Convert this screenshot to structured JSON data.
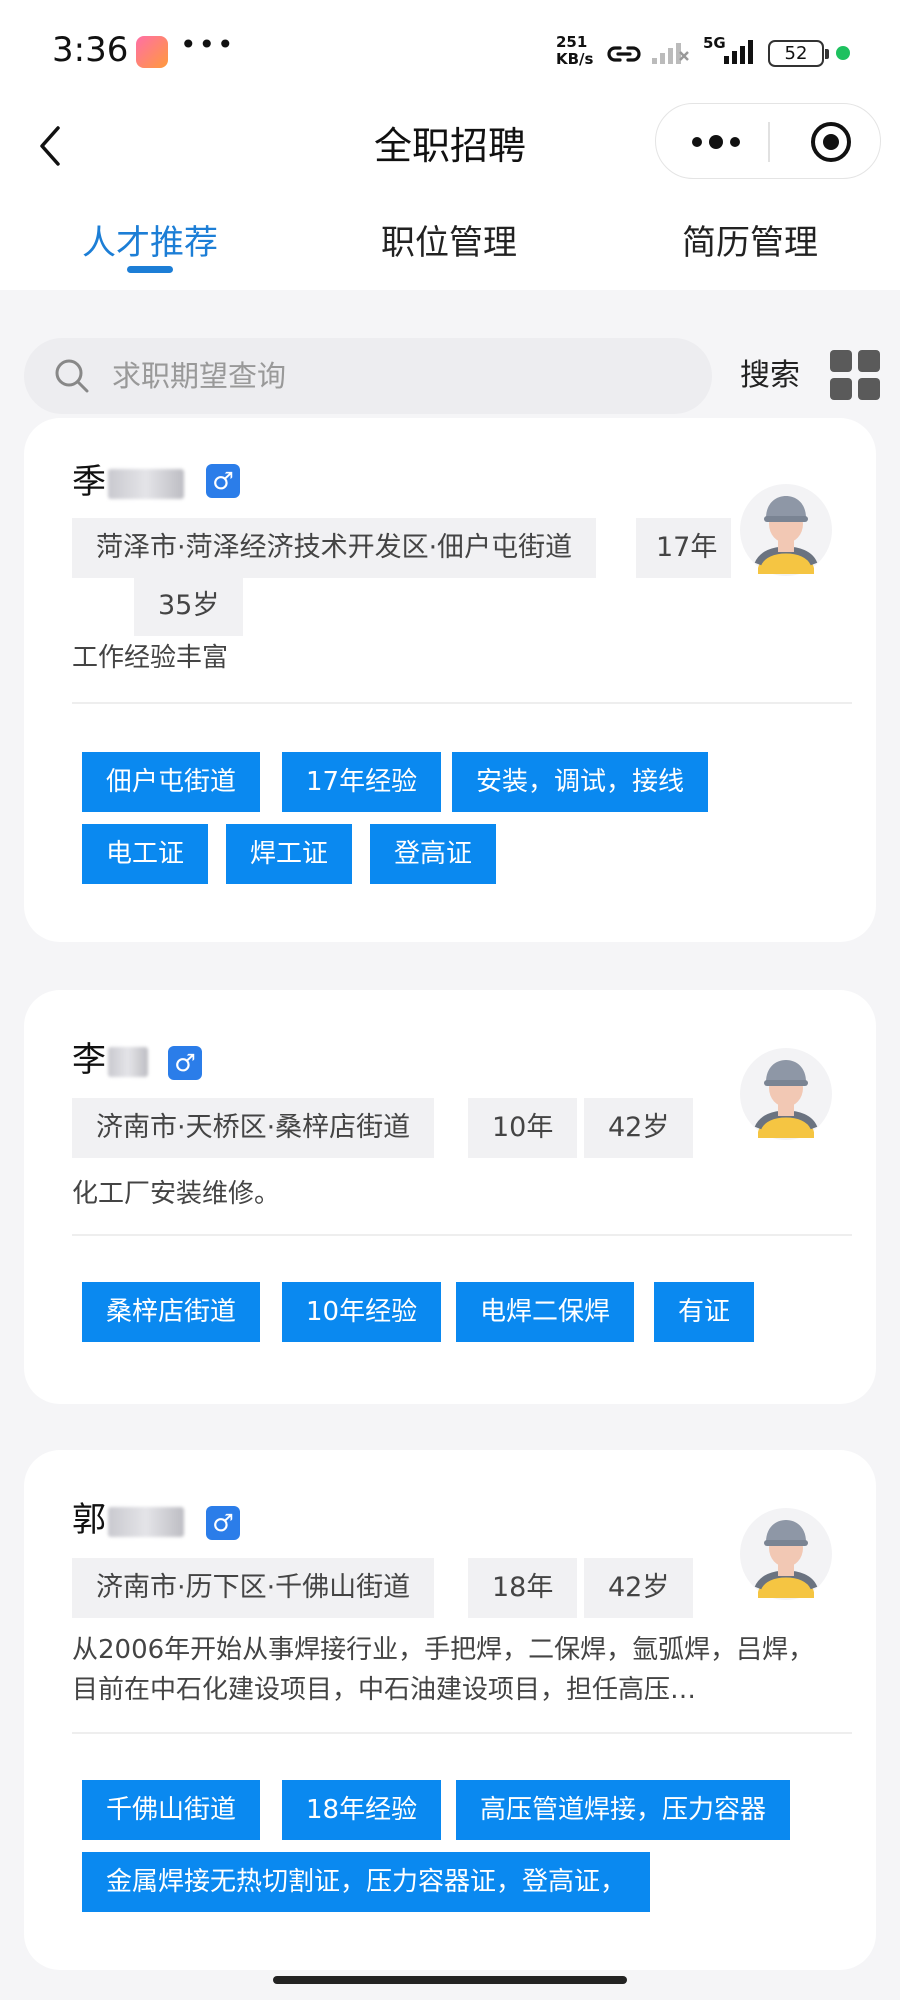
{
  "status_bar": {
    "time": "3:36",
    "dots": "•••",
    "net_speed_value": "251",
    "net_speed_unit": "KB/s",
    "network": "5G",
    "battery": "52",
    "accent": "#1ec15f"
  },
  "header": {
    "title": "全职招聘",
    "tabs": [
      {
        "label": "人才推荐",
        "active": true
      },
      {
        "label": "职位管理",
        "active": false
      },
      {
        "label": "简历管理",
        "active": false
      }
    ],
    "accent": "#1c7ed6"
  },
  "search": {
    "placeholder": "求职期望查询",
    "button_label": "搜索"
  },
  "candidates": [
    {
      "name_visible": "季",
      "gender_icon": "♂",
      "location": "菏泽市·菏泽经济技术开发区·佃户屯街道",
      "experience_years": "17年",
      "age": "35岁",
      "description": "工作经验丰富",
      "skills": [
        "佃户屯街道",
        "17年经验",
        "安装，调试，接线",
        "电工证",
        "焊工证",
        "登高证"
      ]
    },
    {
      "name_visible": "李",
      "gender_icon": "♂",
      "location": "济南市·天桥区·桑梓店街道",
      "experience_years": "10年",
      "age": "42岁",
      "description": "化工厂安装维修。",
      "skills": [
        "桑梓店街道",
        "10年经验",
        "电焊二保焊",
        "有证"
      ]
    },
    {
      "name_visible": "郭",
      "gender_icon": "♂",
      "location": "济南市·历下区·千佛山街道",
      "experience_years": "18年",
      "age": "42岁",
      "description": "从2006年开始从事焊接行业，手把焊，二保焊，氩弧焊，吕焊，目前在中石化建设项目，中石油建设项目，担任高压…",
      "skills": [
        "千佛山街道",
        "18年经验",
        "高压管道焊接，压力容器",
        "金属焊接无热切割证，压力容器证，登高证，"
      ]
    }
  ],
  "colors": {
    "skill_tag": "#0a89f0",
    "gender_badge": "#2b7de9"
  }
}
